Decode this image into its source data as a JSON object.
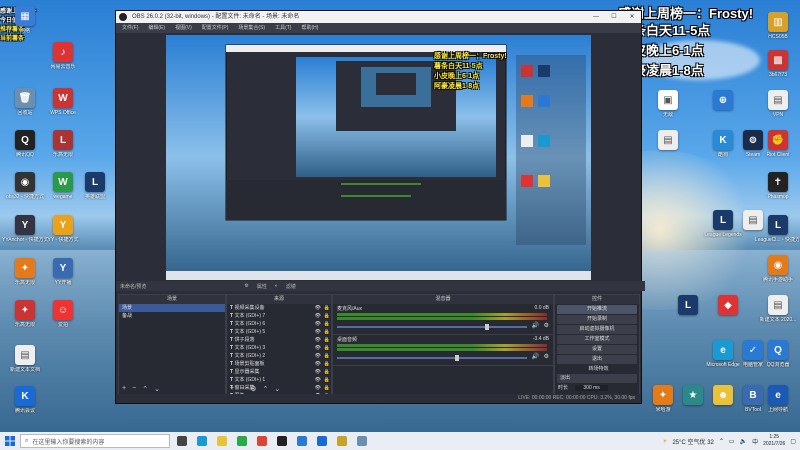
{
  "overlay": {
    "top_right_lines": [
      "感谢上周榜一：Frosty!",
      "薯条白天11-5点",
      "小皮晚上6-1点",
      "阿豪凌晨1-8点"
    ],
    "top_left_lines": [
      "感谢上周榜一",
      "今日值班",
      "推荐薯条",
      "当前薯条"
    ]
  },
  "desktop_icons_left": [
    {
      "label": "网络",
      "color": "#3a7bd5",
      "glyph": "▦"
    },
    {
      "label": "网易云音乐",
      "color": "#d33",
      "glyph": "♪"
    },
    {
      "label": "回收站",
      "color": "#6a8fb0",
      "glyph": "🗑"
    },
    {
      "label": "WPS Office",
      "color": "#c33",
      "glyph": "W"
    },
    {
      "label": "腾讯QQ",
      "color": "#222",
      "glyph": "Q"
    },
    {
      "label": "乐高无限",
      "color": "#a33",
      "glyph": "L"
    },
    {
      "label": "obs32 - 快捷方式",
      "color": "#333",
      "glyph": "◉"
    },
    {
      "label": "wegame",
      "color": "#2a9a4a",
      "glyph": "W"
    },
    {
      "label": "英雄联盟",
      "color": "#1a3a6a",
      "glyph": "L"
    },
    {
      "label": "YYAnchor - 快捷方式",
      "color": "#334",
      "glyph": "Y"
    },
    {
      "label": "YY - 快捷方式",
      "color": "#e9a21a",
      "glyph": "Y"
    },
    {
      "label": "乐高无限",
      "color": "#e57a1a",
      "glyph": "✦"
    },
    {
      "label": "YY开播",
      "color": "#3a6ab0",
      "glyph": "Y"
    },
    {
      "label": "乐高无限",
      "color": "#c33",
      "glyph": "✦"
    },
    {
      "label": "爱拍",
      "color": "#e33",
      "glyph": "☺"
    },
    {
      "label": "新建文本文档",
      "color": "#eee",
      "glyph": "▤"
    },
    {
      "label": "腾讯会议",
      "color": "#1a6ad5",
      "glyph": "K"
    }
  ],
  "desktop_icons_right": [
    {
      "label": "HCS05B",
      "color": "#d6a12a",
      "glyph": "▥"
    },
    {
      "label": "3b67f73",
      "color": "#c33",
      "glyph": "▩"
    },
    {
      "label": "VPN",
      "color": "#eee",
      "glyph": "▤"
    },
    {
      "label": "Riot Client",
      "color": "#c33",
      "glyph": "✊"
    },
    {
      "label": "Phasmop",
      "color": "#222",
      "glyph": "✝"
    },
    {
      "label": "LeagueCl... - 快捷方式",
      "color": "#1a3a6a",
      "glyph": "L"
    },
    {
      "label": "腾讯手游助手",
      "color": "#e57a1a",
      "glyph": "◉"
    },
    {
      "label": "新建文本 2020...",
      "color": "#eee",
      "glyph": "▤"
    },
    {
      "label": "QQ浏览器",
      "color": "#2a7ad5",
      "glyph": "Q"
    },
    {
      "label": "上网导航",
      "color": "#1a5ab5",
      "glyph": "e"
    }
  ],
  "desktop_icons_mid": [
    {
      "label": "无敌",
      "color": "#fff",
      "glyph": "▣"
    },
    {
      "label": "",
      "color": "#2a7ad5",
      "glyph": "⊕"
    },
    {
      "label": "Steam",
      "color": "#1a2a4a",
      "glyph": "⊚"
    },
    {
      "label": "酷狗",
      "color": "#2a8ad5",
      "glyph": "K"
    },
    {
      "label": "",
      "color": "#eee",
      "glyph": "▤"
    },
    {
      "label": "League Legends",
      "color": "#1a3a6a",
      "glyph": "L"
    },
    {
      "label": "",
      "color": "#eee",
      "glyph": "▤"
    },
    {
      "label": "",
      "color": "#1a3a6a",
      "glyph": "L"
    },
    {
      "label": "",
      "color": "#d33",
      "glyph": "◆"
    },
    {
      "label": "Microsoft Edge",
      "color": "#1a9ad5",
      "glyph": "e"
    },
    {
      "label": "电脑管家",
      "color": "#2a7ad5",
      "glyph": "✓"
    },
    {
      "label": "米哈游",
      "color": "#e57a1a",
      "glyph": "✦"
    },
    {
      "label": "",
      "color": "#2a8a8a",
      "glyph": "★"
    },
    {
      "label": "",
      "color": "#e7c23a",
      "glyph": "☻"
    },
    {
      "label": "BVTool",
      "color": "#3a6ab0",
      "glyph": "B"
    }
  ],
  "obs": {
    "title": "OBS 26.0.2 (32-bit, windows) - 配置文件: 未命名 - 场景: 未命名",
    "menu": [
      "文件(F)",
      "编辑(E)",
      "视图(V)",
      "配置文件(P)",
      "场景集合(S)",
      "工具(T)",
      "帮助(H)"
    ],
    "preview_label": "未命名/预览",
    "source_toolbar": [
      "属性",
      "滤镜"
    ],
    "docks": {
      "scenes": {
        "title": "场景",
        "items": [
          "场景",
          "备战"
        ]
      },
      "sources": {
        "title": "来源",
        "items": [
          "视频采集设备",
          "文本 (GDI+) 7",
          "文本 (GDI+) 6",
          "文本 (GDI+) 5",
          "饼子段落",
          "文本 (GDI+) 3",
          "文本 (GDI+) 2",
          "场景剪贴面板",
          "显示器采集",
          "文本 (GDI+) 1",
          "窗口采集",
          "图像"
        ]
      },
      "mixer": {
        "title": "混音器",
        "tracks": [
          {
            "name": "麦克风/Aux",
            "db": "0.0 dB",
            "level": 0.78
          },
          {
            "name": "桌面音频",
            "db": "-3.4 dB",
            "level": 0.62
          }
        ]
      },
      "transition": {
        "title": "转场特效",
        "type": "淡出",
        "duration_label": "时长",
        "duration_value": "300 ms"
      },
      "controls": {
        "title": "控件",
        "buttons": [
          "开始推流",
          "开始录制",
          "启动虚拟摄像机",
          "工作室模式",
          "设置",
          "退出"
        ]
      }
    },
    "status": "LIVE: 00:00:00   REC: 00:00:00   CPU: 3.2%, 30.00 fps"
  },
  "taskbar": {
    "search_placeholder": "在这里输入你要搜索的内容",
    "apps": [
      {
        "name": "task-view",
        "color": "#444"
      },
      {
        "name": "edge",
        "color": "#1a9ad5"
      },
      {
        "name": "file-explorer",
        "color": "#e7c23a"
      },
      {
        "name": "wechat",
        "color": "#2aa84a"
      },
      {
        "name": "chrome",
        "color": "#db4437"
      },
      {
        "name": "obs",
        "color": "#222"
      },
      {
        "name": "qq",
        "color": "#2a7ad5"
      },
      {
        "name": "kugou",
        "color": "#1a6ad5"
      },
      {
        "name": "league",
        "color": "#c9a22a"
      },
      {
        "name": "notepad",
        "color": "#6a8fb0"
      }
    ],
    "weather": "25°C 空气优 32",
    "time": "1:25",
    "date": "2021/7/26"
  }
}
